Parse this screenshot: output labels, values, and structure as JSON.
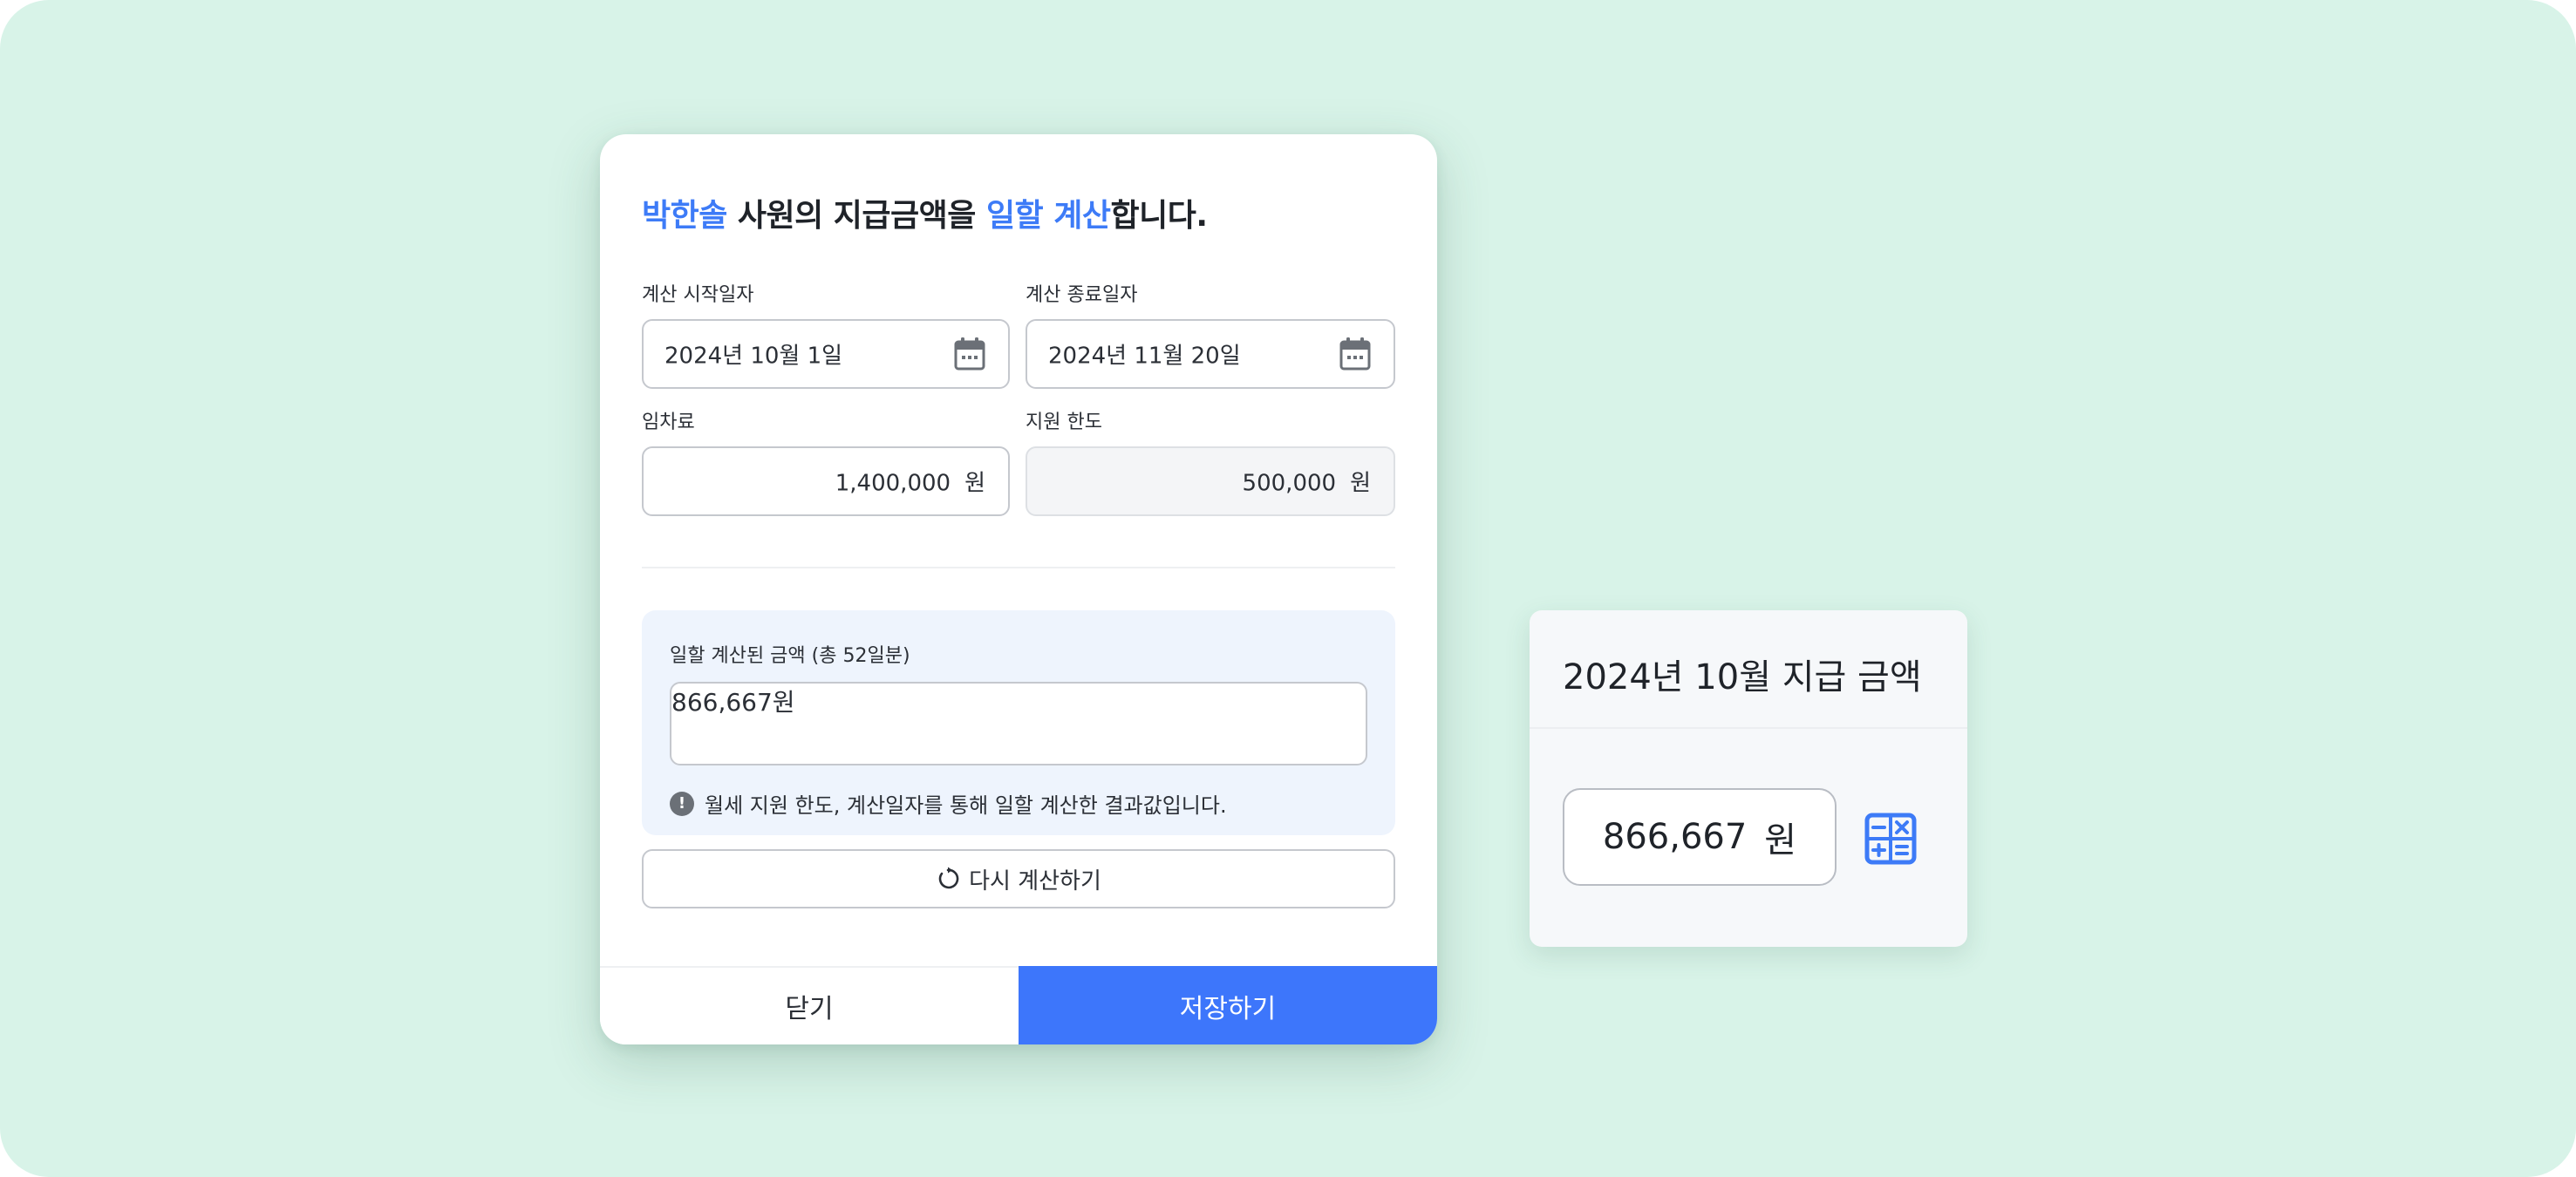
{
  "modal": {
    "title": {
      "name": "박한솔",
      "text1": " 사원의 지급금액을 ",
      "highlight": "일할 계산",
      "text2": "합니다."
    },
    "start_date": {
      "label": "계산 시작일자",
      "value": "2024년 10월 1일",
      "icon": "calendar-icon"
    },
    "end_date": {
      "label": "계산 종료일자",
      "value": "2024년 11월 20일",
      "icon": "calendar-icon"
    },
    "rent": {
      "label": "임차료",
      "value": "1,400,000",
      "unit": "원"
    },
    "support_limit": {
      "label": "지원 한도",
      "value": "500,000",
      "unit": "원"
    },
    "result": {
      "label": "일할 계산된 금액 (총 52일분)",
      "value": "866,667",
      "unit": "원",
      "note": "월세 지원 한도, 계산일자를 통해 일할 계산한 결과값입니다.",
      "note_icon": "!"
    },
    "recalculate_label": "다시 계산하기",
    "close_label": "닫기",
    "save_label": "저장하기"
  },
  "card": {
    "title": "2024년 10월 지급 금액",
    "amount": "866,667",
    "unit": "원",
    "icon": "calculator-icon"
  },
  "colors": {
    "background": "#d8f3e8",
    "accent": "#3d7bf7",
    "primary_button": "#3d76fb",
    "result_panel": "#eef4fd"
  }
}
